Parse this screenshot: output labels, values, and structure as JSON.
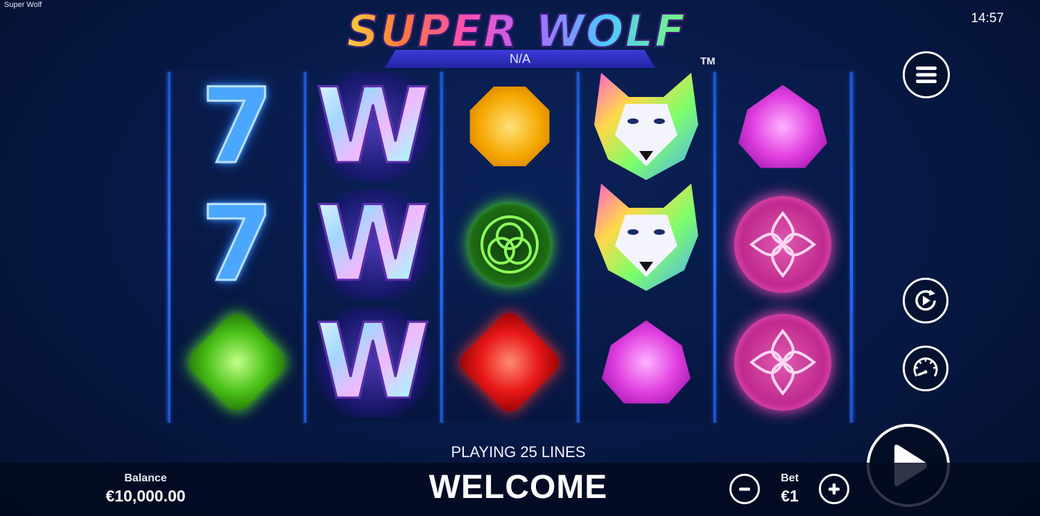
{
  "window_title": "Super Wolf",
  "clock": "14:57",
  "logo": {
    "title": "SUPER WOLF",
    "subtitle": "N/A",
    "trademark": "TM"
  },
  "reels": [
    [
      "seven",
      "seven",
      "green-gem"
    ],
    [
      "wild",
      "wild",
      "wild"
    ],
    [
      "yellow-gem",
      "green-knot",
      "red-gem"
    ],
    [
      "wolf",
      "wolf",
      "purple-gem"
    ],
    [
      "purple-gem",
      "pink-knot",
      "pink-knot"
    ]
  ],
  "symbol_glyphs": {
    "seven": "7",
    "wild": "W"
  },
  "status": {
    "lines_text": "PLAYING 25 LINES",
    "message": "WELCOME"
  },
  "balance": {
    "label": "Balance",
    "value": "€10,000.00"
  },
  "bet": {
    "label": "Bet",
    "value": "€1"
  },
  "controls": {
    "menu_icon": "hamburger-menu-icon",
    "autoplay_icon": "autoplay-icon",
    "speed_icon": "speedometer-icon",
    "spin_icon": "play-triangle-icon",
    "minus_icon": "minus-icon",
    "plus_icon": "plus-icon"
  },
  "colors": {
    "background": "#071a48",
    "reel_separator": "#2a6bff",
    "accent_white": "#ffffff"
  }
}
